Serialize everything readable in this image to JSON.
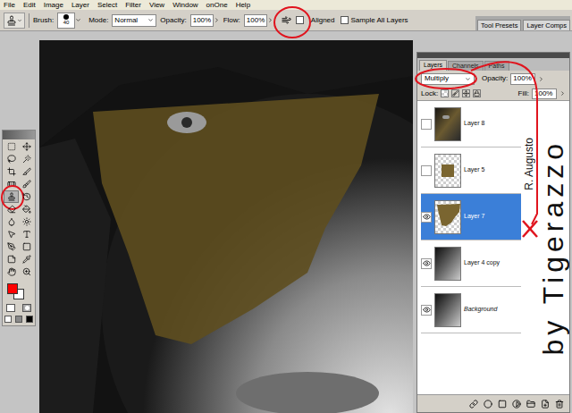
{
  "menu": [
    "File",
    "Edit",
    "Image",
    "Layer",
    "Select",
    "Filter",
    "View",
    "Window",
    "onOne",
    "Help"
  ],
  "options_bar": {
    "brush_label": "Brush:",
    "brush_size": "40",
    "mode_label": "Mode:",
    "mode": "Normal",
    "opacity_label": "Opacity:",
    "opacity": "100%",
    "flow_label": "Flow:",
    "flow": "100%",
    "airbrush": false,
    "checkboxes": [
      {
        "label": "Aligned",
        "checked": false
      },
      {
        "label": "Sample All Layers",
        "checked": false
      }
    ]
  },
  "palette_well": [
    "Tool Presets",
    "Layer Comps"
  ],
  "toolbox": {
    "tools": [
      {
        "selected": false
      },
      {
        "selected": false
      },
      {
        "selected": false
      },
      {
        "selected": false
      },
      {
        "selected": false
      },
      {
        "selected": false
      },
      {
        "selected": false
      },
      {
        "selected": false
      },
      {
        "selected": true
      },
      {
        "selected": false
      },
      {
        "selected": false
      },
      {
        "selected": false
      },
      {
        "selected": false
      },
      {
        "selected": false
      },
      {
        "selected": false
      },
      {
        "selected": false
      },
      {
        "selected": false
      },
      {
        "selected": false
      },
      {
        "selected": false
      },
      {
        "selected": false
      },
      {
        "selected": false
      },
      {
        "selected": false
      }
    ],
    "foreground": "#ff0000",
    "background": "#ffffff"
  },
  "layers_panel": {
    "tabs": [
      {
        "label": "Layers",
        "selected": true
      },
      {
        "label": "Channels",
        "selected": false
      },
      {
        "label": "Paths",
        "selected": false
      }
    ],
    "blend_mode": "Multiply",
    "opacity_label": "Opacity:",
    "opacity": "100%",
    "lock_label": "Lock:",
    "fill_label": "Fill:",
    "fill": "100%",
    "layers": [
      {
        "name": "Layer 8",
        "visible": false,
        "selected": false,
        "thumb": "color-photo",
        "background": false
      },
      {
        "name": "Layer 5",
        "visible": false,
        "selected": false,
        "thumb": "swatch",
        "background": false
      },
      {
        "name": "Layer 7",
        "visible": true,
        "selected": true,
        "thumb": "texture",
        "background": false
      },
      {
        "name": "Layer 4 copy",
        "visible": true,
        "selected": false,
        "thumb": "bw-photo",
        "background": false
      },
      {
        "name": "Background",
        "visible": true,
        "selected": false,
        "thumb": "bw-photo",
        "background": true
      }
    ]
  },
  "watermark": {
    "main": "by Tigerazzo",
    "sub": "R. Augusto"
  }
}
